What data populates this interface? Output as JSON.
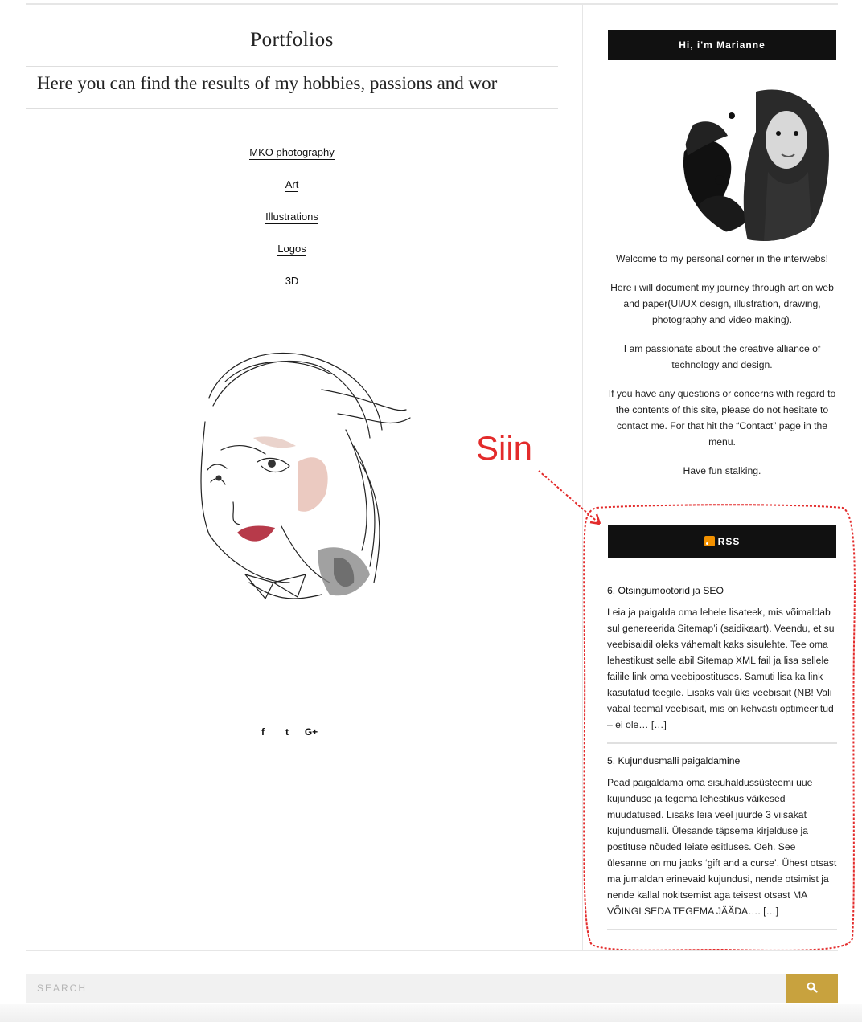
{
  "page": {
    "title": "Portfolios",
    "tagline": "Here you can find the results of my hobbies, passions and wor"
  },
  "portfolio_links": [
    {
      "label": "MKO photography"
    },
    {
      "label": "Art"
    },
    {
      "label": "Illustrations"
    },
    {
      "label": "Logos"
    },
    {
      "label": "3D"
    }
  ],
  "share_icons": [
    "facebook-icon",
    "twitter-icon",
    "google-plus-icon"
  ],
  "share_glyphs": {
    "facebook": "f",
    "twitter": "t",
    "google_plus": "G+"
  },
  "sidebar": {
    "about_heading": "Hi, i'm Marianne",
    "about_paragraphs": [
      "Welcome to my personal corner in the interwebs!",
      "Here i will document my journey through art on web and paper(UI/UX design, illustration, drawing, photography and video making).",
      "I am passionate about the creative alliance of technology and design.",
      "If you have any questions or concerns with regard to the contents of this site, please do not hesitate to contact me. For that hit the “Contact” page in the menu.",
      "Have fun stalking."
    ],
    "rss_heading": "RSS",
    "rss_items": [
      {
        "title": "6. Otsingumootorid ja SEO",
        "excerpt": "Leia ja paigalda oma lehele lisateek, mis võimaldab sul genereerida Sitemap’i (saidikaart). Veendu, et su veebisaidil oleks vähemalt kaks sisulehte. Tee oma lehestikust selle abil Sitemap XML fail ja lisa sellele failile link oma veebipostituses. Samuti lisa ka link kasutatud teegile. Lisaks vali üks veebisait (NB! Vali vabal teemal veebisait, mis on kehvasti optimeeritud – ei ole… […]"
      },
      {
        "title": "5. Kujundusmalli paigaldamine",
        "excerpt": "Pead paigaldama oma sisuhaldussüsteemi uue kujunduse ja tegema lehestikus väikesed muudatused. Lisaks leia veel juurde 3 viisakat kujundusmalli. Ülesande täpsema kirjelduse ja postituse nõuded leiate esitluses.   Oeh. See ülesanne on mu jaoks ‘gift and a curse’. Ühest otsast ma jumaldan erinevaid kujundusi, nende otsimist ja nende kallal nokitsemist aga teisest otsast MA VÕINGI SEDA TEGEMA JÄÄDA…. […]"
      }
    ]
  },
  "annotation": {
    "label": "Siin",
    "color": "#e32b2b"
  },
  "search": {
    "placeholder": "SEARCH",
    "button_icon": "search-icon"
  },
  "colors": {
    "accent": "#c8a23e",
    "widget_bg": "#111111",
    "rss_orange": "#f29100"
  }
}
